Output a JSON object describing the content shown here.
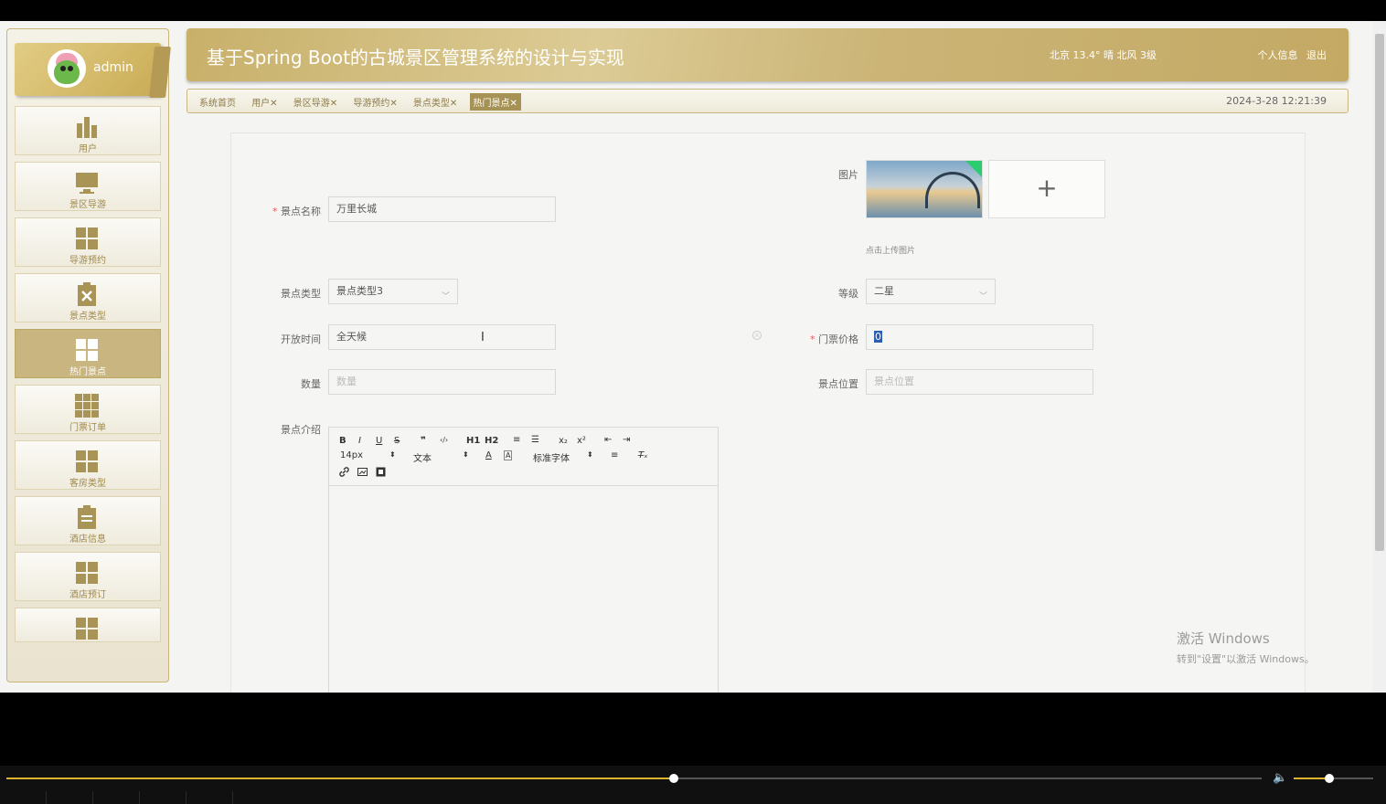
{
  "user": {
    "name": "admin"
  },
  "sidebar": {
    "items": [
      {
        "label": "用户",
        "icon": "bar-chart-icon"
      },
      {
        "label": "景区导游",
        "icon": "monitor-icon"
      },
      {
        "label": "导游预约",
        "icon": "grid-icon"
      },
      {
        "label": "景点类型",
        "icon": "clipboard-x-icon"
      },
      {
        "label": "热门景点",
        "icon": "grid-icon",
        "active": true
      },
      {
        "label": "门票订单",
        "icon": "grid-9-icon"
      },
      {
        "label": "客房类型",
        "icon": "grid-icon"
      },
      {
        "label": "酒店信息",
        "icon": "clipboard-icon"
      },
      {
        "label": "酒店预订",
        "icon": "grid-icon"
      },
      {
        "label": "",
        "icon": "grid-icon"
      }
    ]
  },
  "header": {
    "title": "基于Spring Boot的古城景区管理系统的设计与实现",
    "weather": "北京  13.4°  晴  北风  3级",
    "profile_link": "个人信息",
    "logout_link": "退出"
  },
  "tabs": [
    {
      "label": "系统首页"
    },
    {
      "label": "用户✕"
    },
    {
      "label": "景区导游✕"
    },
    {
      "label": "导游预约✕"
    },
    {
      "label": "景点类型✕"
    },
    {
      "label": "热门景点✕",
      "active": true
    }
  ],
  "datetime": "2024-3-28 12:21:39",
  "form": {
    "name_label": "景点名称",
    "name_value": "万里长城",
    "image_label": "图片",
    "upload_hint": "点击上传图片",
    "upload_plus": "+",
    "type_label": "景点类型",
    "type_value": "景点类型3",
    "grade_label": "等级",
    "grade_value": "二星",
    "open_label": "开放时间",
    "open_value": "全天候",
    "price_label": "门票价格",
    "price_value": "0",
    "qty_label": "数量",
    "qty_placeholder": "数量",
    "location_label": "景点位置",
    "location_placeholder": "景点位置",
    "intro_label": "景点介绍"
  },
  "editor": {
    "font_size": "14px",
    "block_style": "文本",
    "font_family": "标准字体",
    "buttons": [
      "B",
      "I",
      "U",
      "S",
      "❞",
      "‹/›",
      "H1",
      "H2",
      "≡",
      "☰",
      "x₂",
      "x²",
      "⇤",
      "⇥"
    ]
  },
  "watermark": {
    "line1": "激活 Windows",
    "line2": "转到\"设置\"以激活 Windows。"
  },
  "player": {
    "progress": 0.532,
    "volume": 0.45
  },
  "colors": {
    "accent": "#c8b06a",
    "active_tab": "#a79255",
    "progress": "#e0b42c"
  }
}
